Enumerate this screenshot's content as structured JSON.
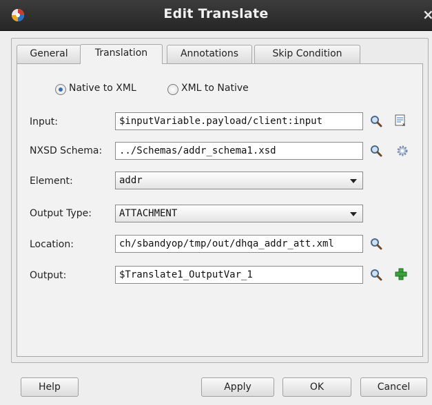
{
  "window": {
    "title": "Edit Translate",
    "close_glyph": "×"
  },
  "tabs": [
    {
      "label": "General",
      "active": false
    },
    {
      "label": "Translation",
      "active": true
    },
    {
      "label": "Annotations",
      "active": false
    },
    {
      "label": "Skip Condition",
      "active": false
    }
  ],
  "direction": {
    "options": [
      "Native to XML",
      "XML to Native"
    ],
    "selected": "Native to XML"
  },
  "form": {
    "input": {
      "label": "Input:",
      "value": "$inputVariable.payload/client:input"
    },
    "nxsd_schema": {
      "label": "NXSD Schema:",
      "value": "../Schemas/addr_schema1.xsd"
    },
    "element": {
      "label": "Element:",
      "value": "addr"
    },
    "output_type": {
      "label": "Output Type:",
      "value": "ATTACHMENT"
    },
    "location": {
      "label": "Location:",
      "value": "ch/sbandyop/tmp/out/dhqa_addr_att.xml"
    },
    "output": {
      "label": "Output:",
      "value": "$Translate1_OutputVar_1"
    }
  },
  "buttons": {
    "help": "Help",
    "apply": "Apply",
    "ok": "OK",
    "cancel": "Cancel"
  },
  "icons": {
    "app": "oracle-app-icon",
    "search": "magnifier-search-icon",
    "expression": "expression-builder-icon",
    "settings": "gear-icon",
    "add": "green-plus-icon"
  }
}
